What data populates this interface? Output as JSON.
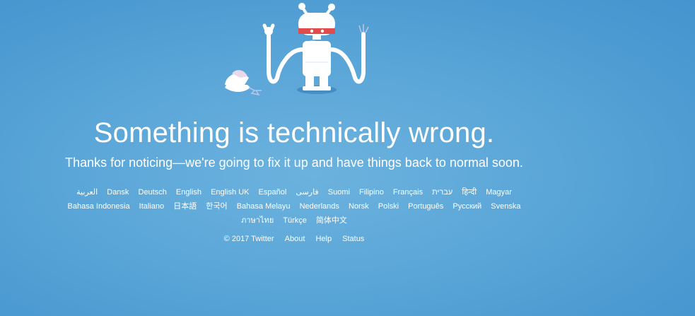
{
  "page": {
    "headline": "Something is technically wrong.",
    "subline": "Thanks for noticing—we're going to fix it up and have things back to normal soon."
  },
  "illustration": {
    "icon": "broken-robot-illustration",
    "colors": {
      "robot": "#ffffff",
      "visor": "#e04b4b",
      "shadow": "#3f86bb",
      "spark": "#b9c7e8"
    }
  },
  "languages": [
    "العربية",
    "Dansk",
    "Deutsch",
    "English",
    "English UK",
    "Español",
    "فارسی",
    "Suomi",
    "Filipino",
    "Français",
    "עברית",
    "हिन्दी",
    "Magyar",
    "Bahasa Indonesia",
    "Italiano",
    "日本語",
    "한국어",
    "Bahasa Melayu",
    "Nederlands",
    "Norsk",
    "Polski",
    "Português",
    "Русский",
    "Svenska",
    "ภาษาไทย",
    "Türkçe",
    "简体中文"
  ],
  "footer": {
    "copyright": "© 2017 Twitter",
    "about": "About",
    "help": "Help",
    "status": "Status"
  },
  "colors": {
    "background": "#5aa6d8",
    "text": "#ffffff"
  }
}
